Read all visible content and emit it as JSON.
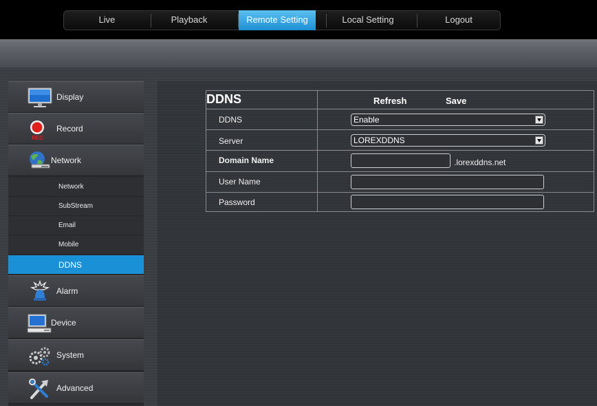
{
  "nav": {
    "tabs": [
      {
        "label": "Live"
      },
      {
        "label": "Playback"
      },
      {
        "label": "Remote Setting"
      },
      {
        "label": "Local Setting"
      },
      {
        "label": "Logout"
      }
    ],
    "active": "Remote Setting"
  },
  "sidebar": {
    "items": [
      {
        "label": "Display",
        "icon": "monitor-icon"
      },
      {
        "label": "Record",
        "icon": "record-icon",
        "badge": "REC"
      },
      {
        "label": "Network",
        "icon": "network-icon"
      },
      {
        "label": "Alarm",
        "icon": "alarm-icon"
      },
      {
        "label": "Device",
        "icon": "device-icon"
      },
      {
        "label": "System",
        "icon": "gears-icon"
      },
      {
        "label": "Advanced",
        "icon": "tools-icon"
      }
    ],
    "network_sub": [
      {
        "label": "Network"
      },
      {
        "label": "SubStream"
      },
      {
        "label": "Email"
      },
      {
        "label": "Mobile"
      },
      {
        "label": "DDNS"
      }
    ],
    "active_sub": "DDNS"
  },
  "ddns": {
    "title": "DDNS",
    "refresh_label": "Refresh",
    "save_label": "Save",
    "rows": {
      "ddns_label": "DDNS",
      "ddns_value": "Enable",
      "server_label": "Server",
      "server_value": "LOREXDDNS",
      "domain_label": "Domain Name",
      "domain_value": "",
      "domain_suffix": ".lorexddns.net",
      "user_label": "User Name",
      "user_value": "",
      "password_label": "Password",
      "password_value": ""
    }
  },
  "colors": {
    "accent": "#1a91d6",
    "tab_active": "#3ba7e6",
    "background": "#3b3e43"
  }
}
